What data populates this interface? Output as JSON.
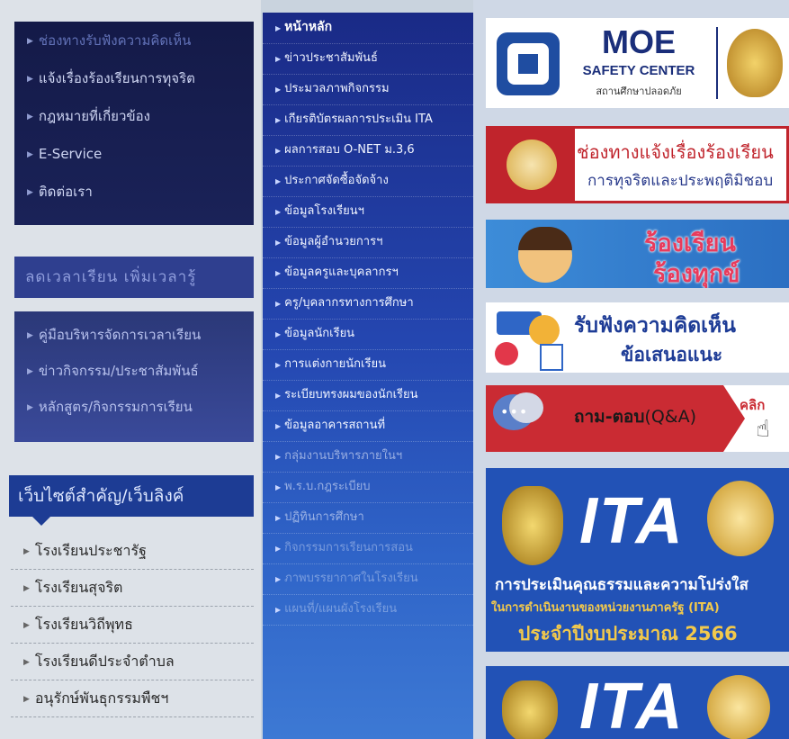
{
  "left": {
    "top_links": [
      {
        "label": "ช่องทางรับฟังความคิดเห็น"
      },
      {
        "label": "แจ้งเรื่องร้องเรียนการทุจริต"
      },
      {
        "label": "กฎหมายที่เกี่ยวข้อง"
      },
      {
        "label": "E-Service"
      },
      {
        "label": "ติดต่อเรา"
      }
    ],
    "reduce_header": "ลดเวลาเรียน เพิ่มเวลารู้",
    "reduce_links": [
      {
        "label": "คู่มือบริหารจัดการเวลาเรียน"
      },
      {
        "label": "ข่าวกิจกรรม/ประชาสัมพันธ์"
      },
      {
        "label": "หลักสูตร/กิจกรรมการเรียน"
      }
    ],
    "websites_header": "เว็บไซต์สำคัญ/เว็บลิงค์",
    "websites_links": [
      {
        "label": "โรงเรียนประชารัฐ"
      },
      {
        "label": "โรงเรียนสุจริต"
      },
      {
        "label": "โรงเรียนวิถีพุทธ"
      },
      {
        "label": "โรงเรียนดีประจำตำบล"
      },
      {
        "label": "อนุรักษ์พันธุกรรมพืชฯ"
      }
    ]
  },
  "menu": {
    "items": [
      {
        "label": "หน้าหลัก"
      },
      {
        "label": "ข่าวประชาสัมพันธ์"
      },
      {
        "label": "ประมวลภาพกิจกรรม"
      },
      {
        "label": "เกียรติบัตรผลการประเมิน ITA"
      },
      {
        "label": "ผลการสอบ O-NET ม.3,6"
      },
      {
        "label": "ประกาศจัดซื้อจัดจ้าง"
      },
      {
        "label": "ข้อมูลโรงเรียนฯ"
      },
      {
        "label": "ข้อมูลผู้อำนวยการฯ"
      },
      {
        "label": "ข้อมูลครูและบุคลากรฯ"
      },
      {
        "label": "ครู/บุคลากรทางการศึกษา"
      },
      {
        "label": "ข้อมูลนักเรียน"
      },
      {
        "label": "การแต่งกายนักเรียน"
      },
      {
        "label": "ระเบียบทรงผมของนักเรียน"
      },
      {
        "label": "ข้อมูลอาคารสถานที่"
      },
      {
        "label": "กลุ่มงานบริหารภายในฯ"
      },
      {
        "label": "พ.ร.บ.กฎระเบียบ"
      },
      {
        "label": "ปฏิทินการศึกษา"
      },
      {
        "label": "กิจกรรมการเรียนการสอน"
      },
      {
        "label": "ภาพบรรยากาศในโรงเรียน"
      },
      {
        "label": "แผนที่/แผนผังโรงเรียน"
      }
    ]
  },
  "banners": {
    "moe_title": "MOE",
    "moe_subtitle": "SAFETY CENTER",
    "moe_thai": "สถานศึกษาปลอดภัย",
    "complaint_line1": "ช่องทางแจ้งเรื่องร้องเรียน",
    "complaint_line2": "การทุจริตและประพฤติมิชอบ",
    "petition_line1": "ร้องเรียน",
    "petition_line2": "ร้องทุกข์",
    "opinion_line1": "รับฟังความคิดเห็น",
    "opinion_line2": "ข้อเสนอแนะ",
    "qa_label": "ถาม-ตอบ",
    "qa_label_en": "(Q&A)",
    "qa_click": "คลิก",
    "ita_logo": "ITA",
    "ita_line1": "การประเมินคุณธรรมและความโปร่งใส",
    "ita_line2": "ในการดำเนินงานของหน่วยงานภาครัฐ (ITA)",
    "ita_line3": "ประจำปีงบประมาณ 2566"
  },
  "colors": {
    "menu_blue": "#2446b0",
    "qa_red": "#ca2b33",
    "ita_blue": "#2252b6",
    "moe_navy": "#1a2e7a"
  }
}
